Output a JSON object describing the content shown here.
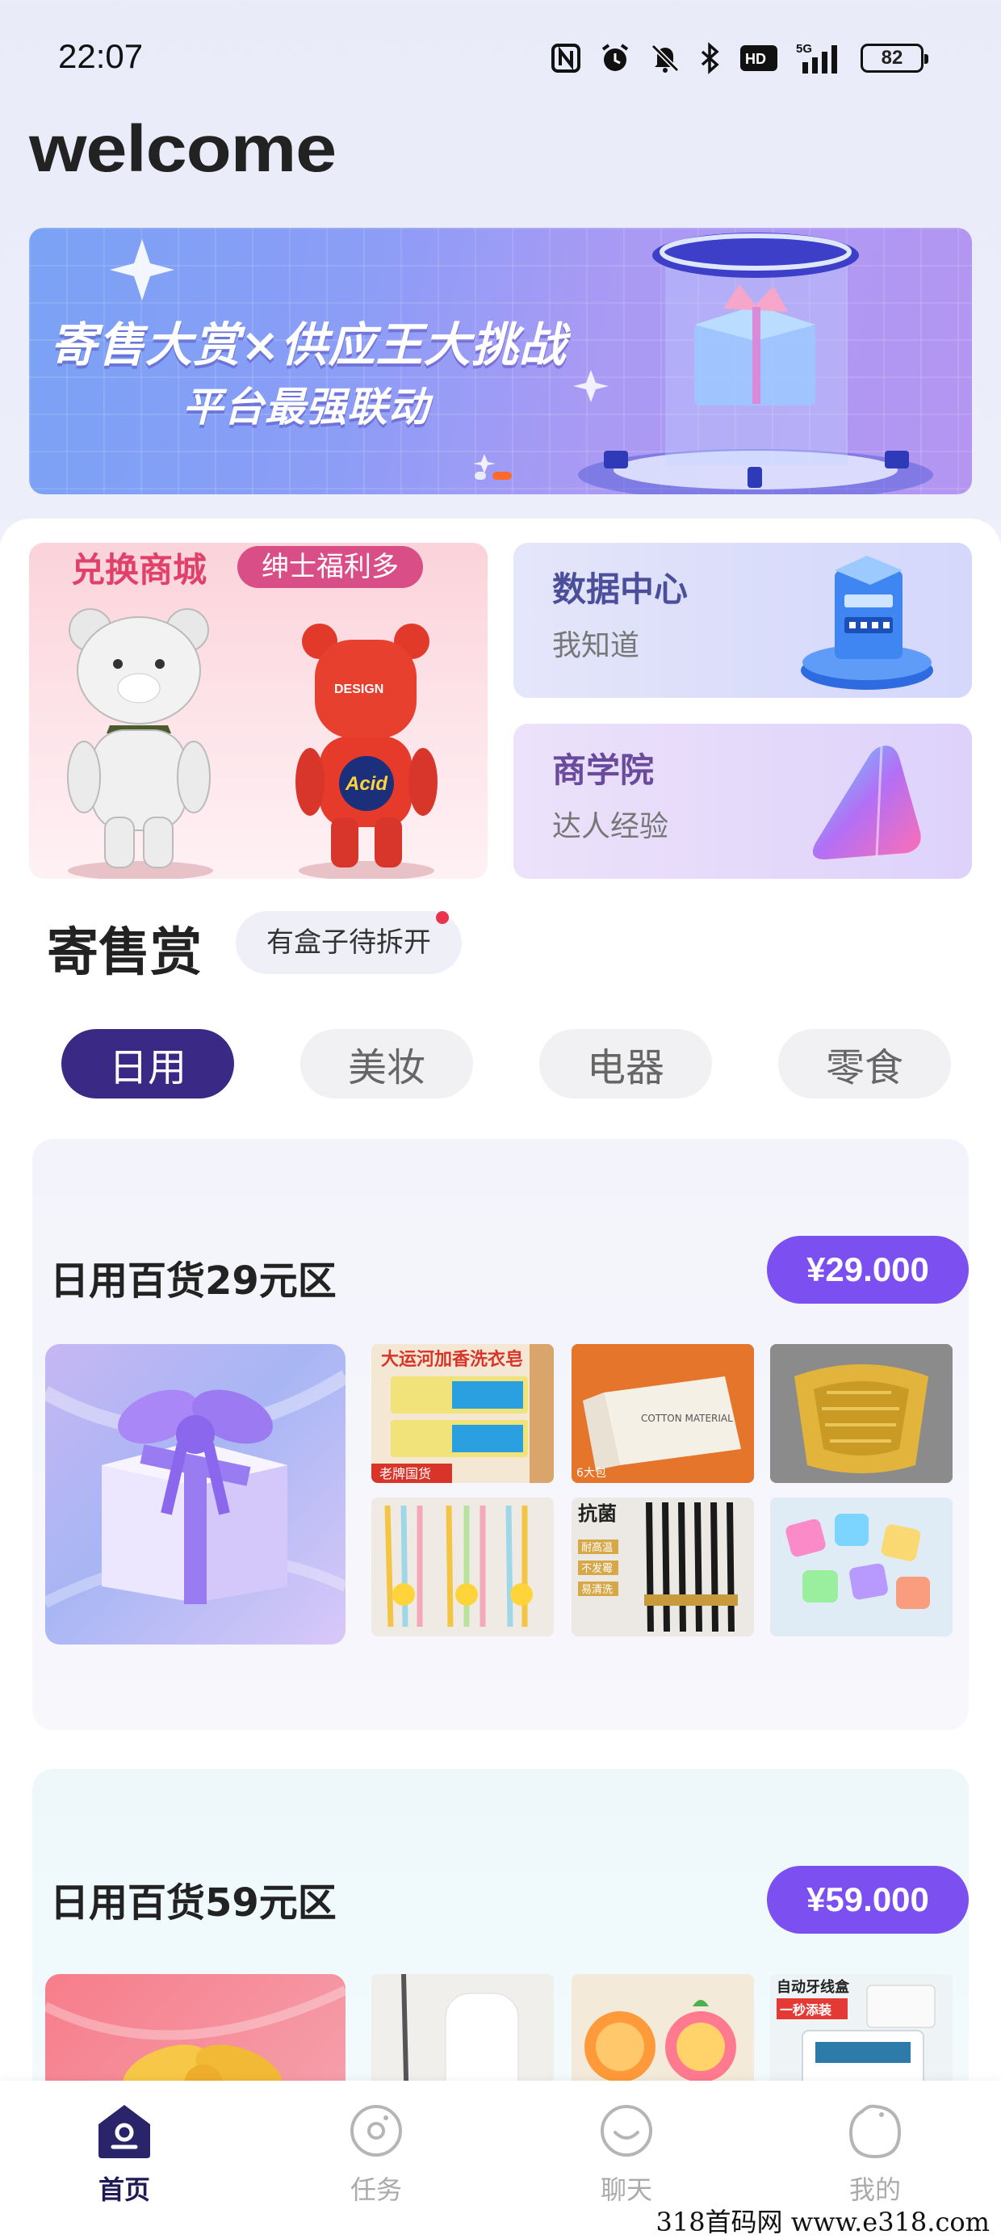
{
  "status_bar": {
    "time": "22:07",
    "network": "5G",
    "battery": "82"
  },
  "header": {
    "welcome": "welcome"
  },
  "banner": {
    "title": "寄售大赏×供应王大挑战",
    "subtitle": "平台最强联动",
    "active_slide": 2,
    "slide_count": 2
  },
  "quick_cards": {
    "exchange": {
      "title": "兑换商城",
      "badge": "绅士福利多"
    },
    "data_center": {
      "title": "数据中心",
      "subtitle": "我知道"
    },
    "school": {
      "title": "商学院",
      "subtitle": "达人经验"
    }
  },
  "section": {
    "title": "寄售赏",
    "pill": "有盒子待拆开"
  },
  "tabs": [
    {
      "label": "日用",
      "active": true
    },
    {
      "label": "美妆",
      "active": false
    },
    {
      "label": "电器",
      "active": false
    },
    {
      "label": "零食",
      "active": false
    }
  ],
  "zones": [
    {
      "title": "日用百货29元区",
      "price": "¥29.000",
      "thumbs": [
        {
          "name": "laundry-soap",
          "label": "大运河加香洗衣皂",
          "caption": "老牌国货"
        },
        {
          "name": "tissue-box",
          "label": "COTTON MATERIAL",
          "caption": "6大包"
        },
        {
          "name": "drain-basket"
        },
        {
          "name": "toothbrushes"
        },
        {
          "name": "chopsticks",
          "label": "抗菌",
          "lines": [
            "耐高温",
            "不发霉",
            "易清洗"
          ]
        },
        {
          "name": "ice-cubes"
        }
      ]
    },
    {
      "title": "日用百货59元区",
      "price": "¥59.000",
      "thumbs": [
        {
          "name": "mop"
        },
        {
          "name": "sponges"
        },
        {
          "name": "floss-box",
          "label": "自动牙线盒",
          "badge": "一秒添装"
        }
      ]
    }
  ],
  "bottom_nav": [
    {
      "label": "首页",
      "active": true,
      "icon": "home-icon"
    },
    {
      "label": "任务",
      "active": false,
      "icon": "task-icon"
    },
    {
      "label": "聊天",
      "active": false,
      "icon": "chat-icon"
    },
    {
      "label": "我的",
      "active": false,
      "icon": "profile-icon"
    }
  ],
  "watermark": "318首码网  www.e318.com",
  "colors": {
    "accent": "#7b4ff0",
    "tab_active": "#3b2a85",
    "badge_pink": "#d94e86",
    "nav_active": "#1f1a55"
  }
}
